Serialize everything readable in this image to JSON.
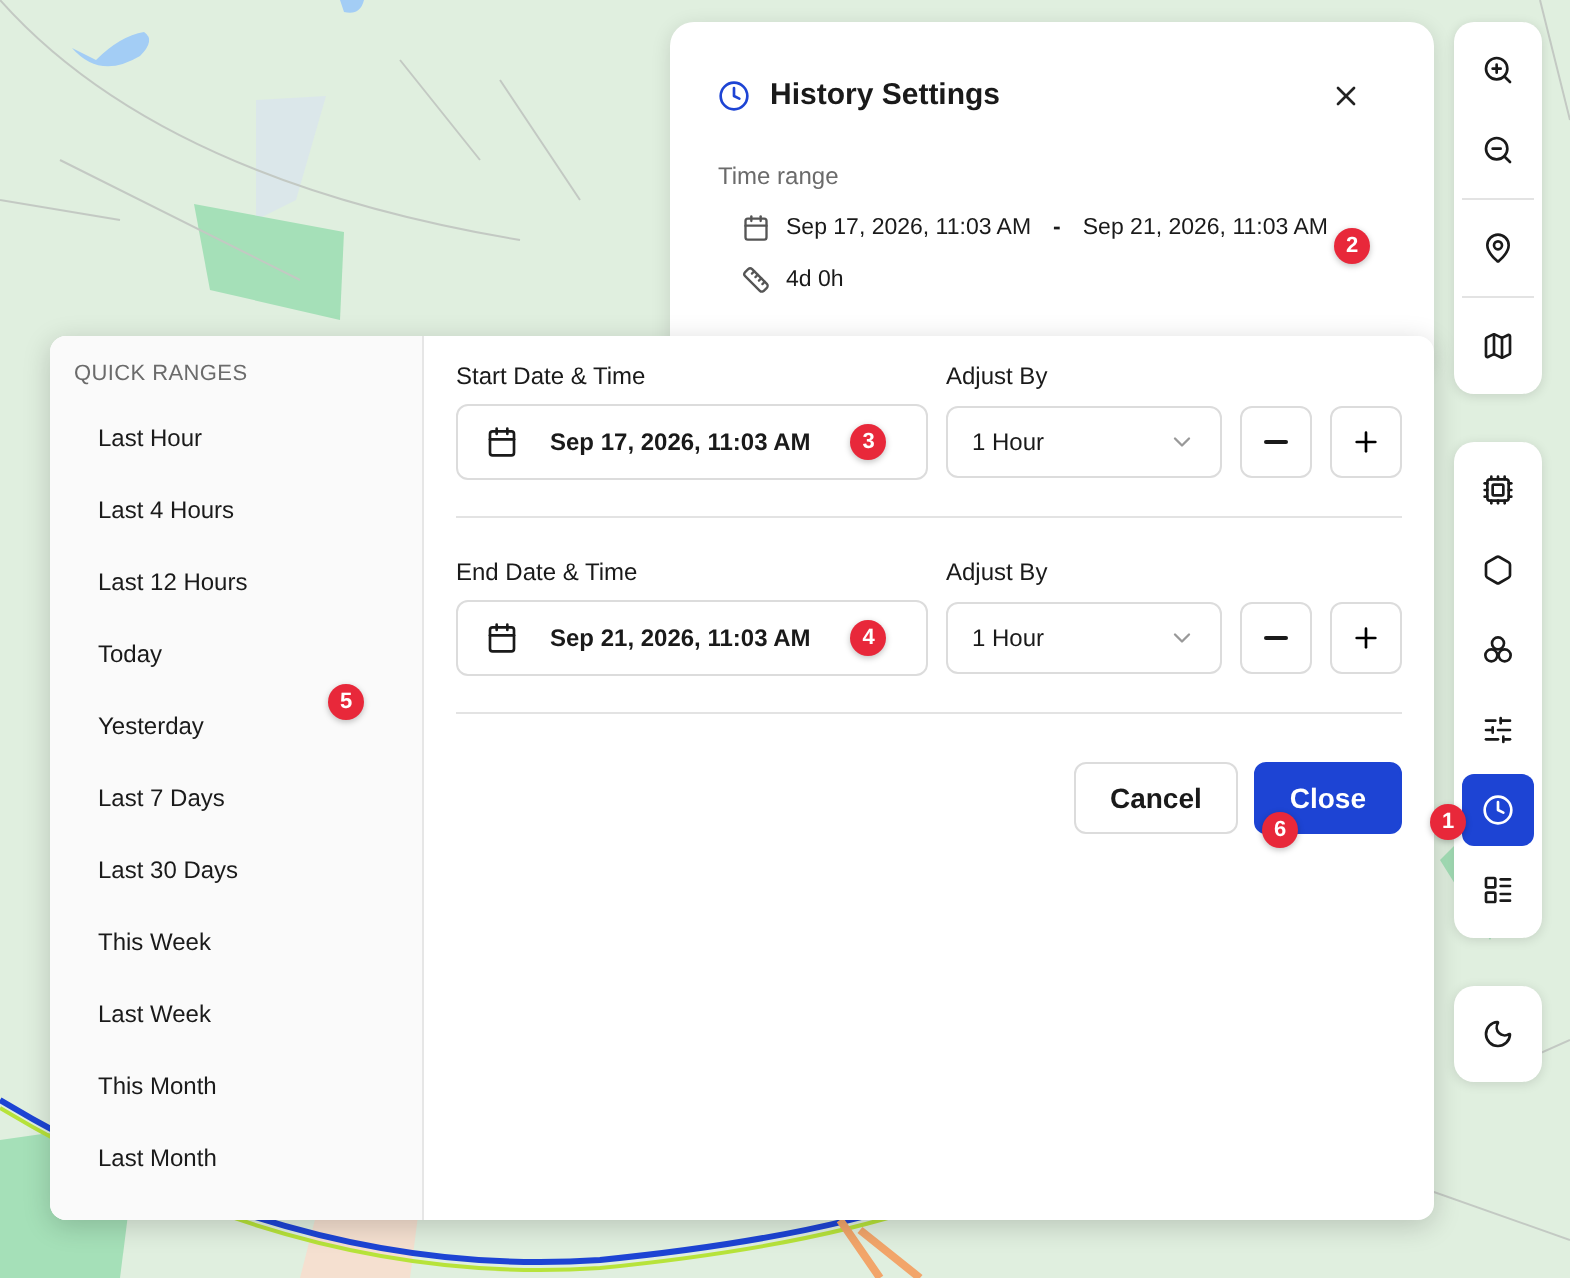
{
  "history_panel": {
    "title": "History Settings",
    "time_range_label": "Time range",
    "range_start": "Sep 17, 2026, 11:03 AM",
    "range_separator": "-",
    "range_end": "Sep 21, 2026, 11:03 AM",
    "duration": "4d 0h"
  },
  "quick_ranges": {
    "heading": "QUICK RANGES",
    "items": [
      "Last Hour",
      "Last 4 Hours",
      "Last 12 Hours",
      "Today",
      "Yesterday",
      "Last 7 Days",
      "Last 30 Days",
      "This Week",
      "Last Week",
      "This Month",
      "Last Month"
    ]
  },
  "date_rows": [
    {
      "label": "Start Date & Time",
      "value": "Sep 17, 2026, 11:03 AM",
      "adjust_label": "Adjust By",
      "adjust_value": "1 Hour",
      "marker": "3"
    },
    {
      "label": "End Date & Time",
      "value": "Sep 21, 2026, 11:03 AM",
      "adjust_label": "Adjust By",
      "adjust_value": "1 Hour",
      "marker": "4"
    }
  ],
  "buttons": [
    {
      "label": "Cancel",
      "kind": "secondary"
    },
    {
      "label": "Close",
      "kind": "primary"
    }
  ],
  "toolbar_groups": [
    [
      {
        "kind": "zoom-in",
        "selected": false
      },
      {
        "kind": "zoom-out",
        "selected": false
      },
      {
        "kind": "divider"
      },
      {
        "kind": "pin",
        "selected": false
      },
      {
        "kind": "divider"
      },
      {
        "kind": "map",
        "selected": false
      }
    ],
    [
      {
        "kind": "chip",
        "selected": false
      },
      {
        "kind": "hexagon",
        "selected": false
      },
      {
        "kind": "circles",
        "selected": false
      },
      {
        "kind": "sliders",
        "selected": false
      },
      {
        "kind": "clock",
        "selected": true
      },
      {
        "kind": "list",
        "selected": false
      }
    ],
    [
      {
        "kind": "moon",
        "selected": false
      }
    ]
  ],
  "markers": [
    "1",
    "2",
    "5",
    "6"
  ]
}
